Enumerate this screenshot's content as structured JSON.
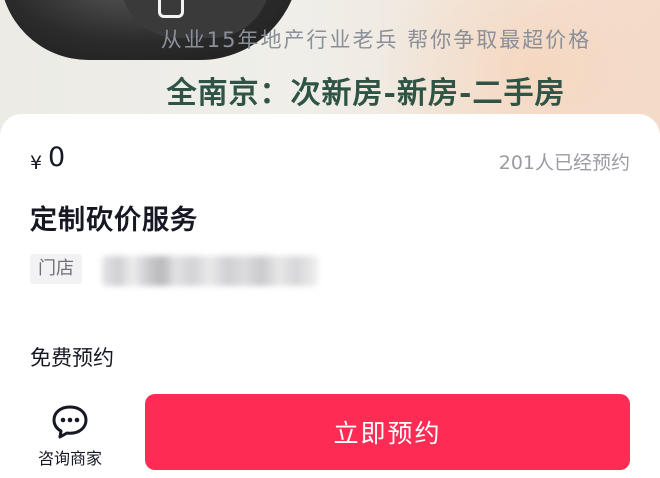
{
  "banner": {
    "tagline": "从业15年地产行业老兵 帮你争取最超价格",
    "headline": "全南京：次新房-新房-二手房"
  },
  "product": {
    "currency": "¥",
    "price": "0",
    "booked_count": "201人已经预约",
    "service_title": "定制砍价服务",
    "store_tag": "门店",
    "booking_type": "免费预约"
  },
  "bottom_bar": {
    "contact_icon": "chat-bubble-icon",
    "contact_label": "咨询商家",
    "book_button_label": "立即预约"
  },
  "colors": {
    "accent": "#fe2c55",
    "headline": "#2f5446",
    "muted_text": "#9b9ca3"
  }
}
